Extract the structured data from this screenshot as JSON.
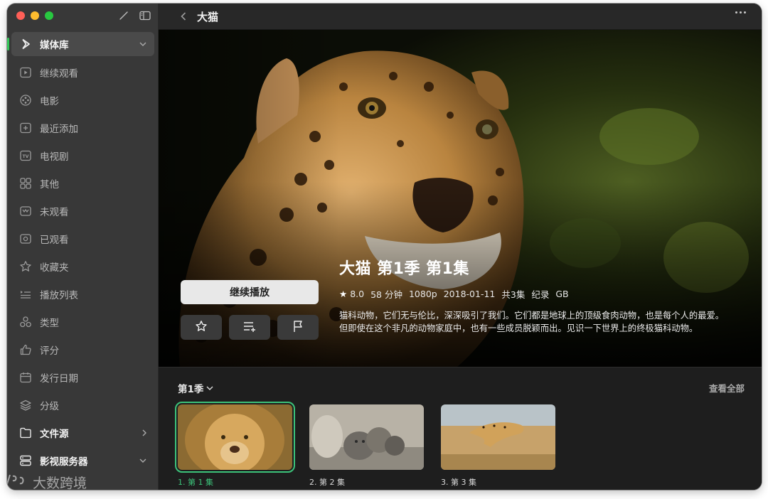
{
  "window": {
    "title": "大猫"
  },
  "sidebar": {
    "items": [
      {
        "label": "媒体库",
        "icon": "play-logo-icon"
      },
      {
        "label": "继续观看",
        "icon": "play-square-icon"
      },
      {
        "label": "电影",
        "icon": "film-reel-icon"
      },
      {
        "label": "最近添加",
        "icon": "plus-square-icon"
      },
      {
        "label": "电视剧",
        "icon": "tv-icon"
      },
      {
        "label": "其他",
        "icon": "grid-icon"
      },
      {
        "label": "未观看",
        "icon": "unwatched-icon"
      },
      {
        "label": "已观看",
        "icon": "watched-icon"
      },
      {
        "label": "收藏夹",
        "icon": "star-icon"
      },
      {
        "label": "播放列表",
        "icon": "playlist-icon"
      },
      {
        "label": "类型",
        "icon": "shapes-icon"
      },
      {
        "label": "评分",
        "icon": "thumbs-up-icon"
      },
      {
        "label": "发行日期",
        "icon": "calendar-icon"
      },
      {
        "label": "分级",
        "icon": "layers-icon"
      },
      {
        "label": "文件源",
        "icon": "folder-icon"
      },
      {
        "label": "影视服务器",
        "icon": "server-icon"
      }
    ],
    "watermark": "大数跨境"
  },
  "hero": {
    "episode_title": "大猫 第1季 第1集",
    "rating": "8.0",
    "duration": "58 分钟",
    "resolution": "1080p",
    "date": "2018-01-11",
    "episode_count": "共3集",
    "genre": "纪录",
    "region": "GB",
    "description_line1": "猫科动物，它们无与伦比，深深吸引了我们。它们都是地球上的顶级食肉动物，也是每个人的最爱。",
    "description_line2": "但即使在这个非凡的动物家庭中，也有一些成员脱颖而出。见识一下世界上的终极猫科动物。",
    "play_label": "继续播放"
  },
  "episodes": {
    "season_label": "第1季",
    "view_all_label": "查看全部",
    "items": [
      {
        "label": "1. 第 1 集"
      },
      {
        "label": "2. 第 2 集"
      },
      {
        "label": "3. 第 3 集"
      }
    ]
  },
  "colors": {
    "accent_green": "#3cc37a",
    "sidebar_bg": "#383838",
    "main_bg": "#1e1e1e"
  }
}
